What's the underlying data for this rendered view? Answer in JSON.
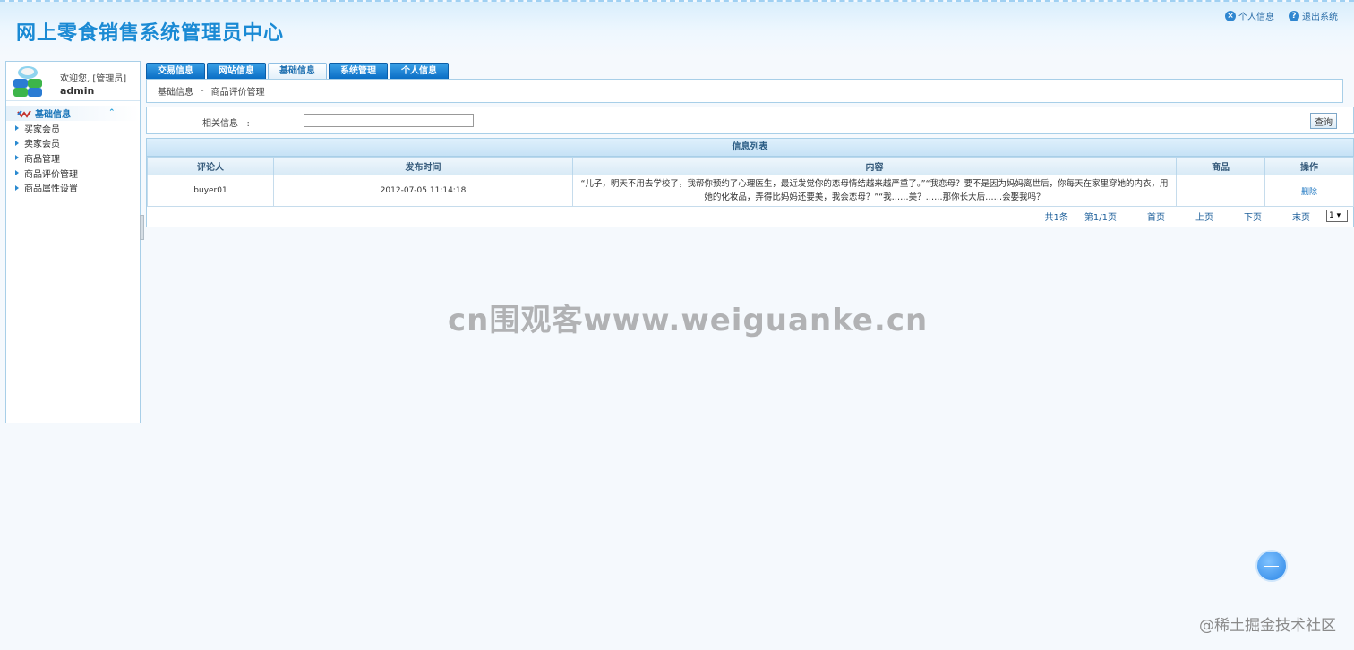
{
  "header": {
    "title": "网上零食销售系统管理员中心",
    "links": [
      {
        "icon": "x-circle-icon",
        "label": "个人信息"
      },
      {
        "icon": "question-circle-icon",
        "label": "退出系统"
      }
    ]
  },
  "user": {
    "welcome": "欢迎您, [管理员]",
    "name": "admin"
  },
  "sidebar": {
    "section_label": "基础信息",
    "items": [
      "买家会员",
      "卖家会员",
      "商品管理",
      "商品评价管理",
      "商品属性设置"
    ]
  },
  "tabs": [
    "交易信息",
    "网站信息",
    "基础信息",
    "系统管理",
    "个人信息"
  ],
  "breadcrumb": {
    "parent": "基础信息",
    "separator": "-",
    "current": "商品评价管理"
  },
  "search": {
    "label": "相关信息",
    "colon": ":",
    "value": "",
    "button": "查询"
  },
  "list": {
    "title": "信息列表",
    "columns": [
      "评论人",
      "发布时间",
      "内容",
      "商品",
      "操作"
    ],
    "rows": [
      {
        "reviewer": "buyer01",
        "time": "2012-07-05 11:14:18",
        "content": "“儿子，明天不用去学校了，我帮你预约了心理医生，最近发觉你的恋母情结越来越严重了。”“我恋母？要不是因为妈妈离世后，你每天在家里穿她的内衣，用她的化妆品，弄得比妈妈还要美，我会恋母？”“我……美？……那你长大后……会娶我吗？",
        "product": "",
        "action": "删除"
      }
    ]
  },
  "pager": {
    "total": "共1条",
    "page": "第1/1页",
    "first": "首页",
    "prev": "上页",
    "next": "下页",
    "last": "末页",
    "select_value": "1 ▾"
  },
  "watermark": "cn围观客www.weiguanke.cn",
  "corner_watermark": "@稀土掘金技术社区"
}
